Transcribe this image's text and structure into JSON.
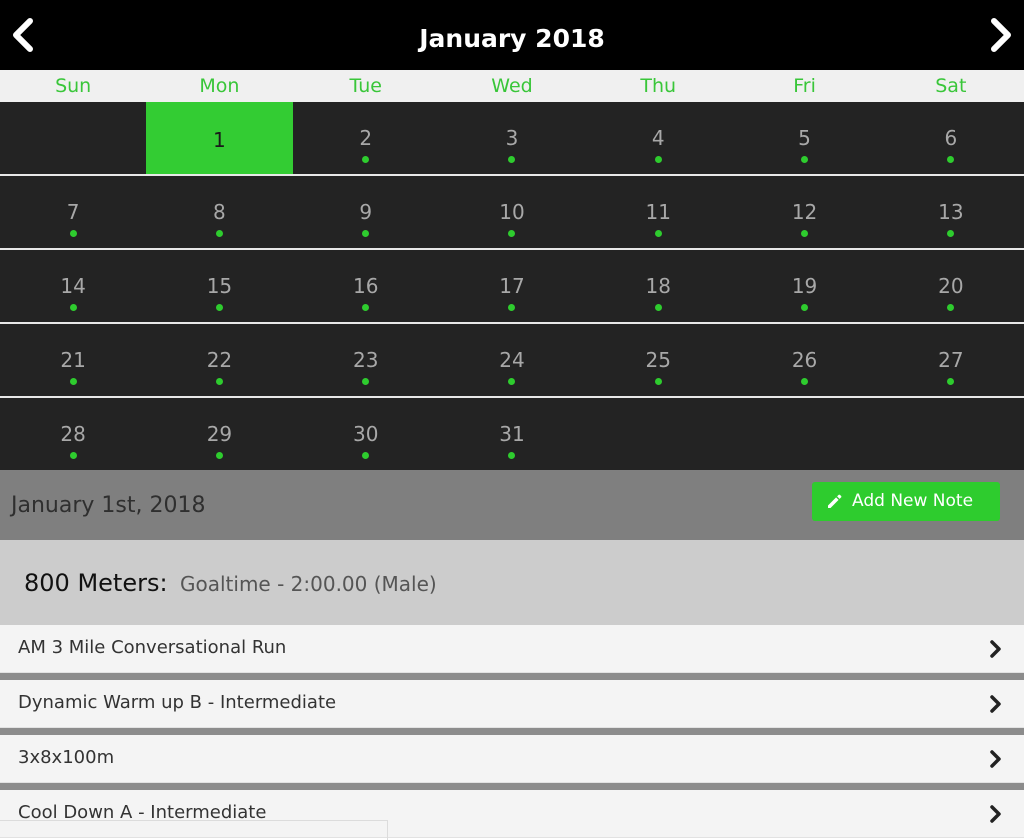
{
  "calendar": {
    "title": "January 2018",
    "weekdays": [
      "Sun",
      "Mon",
      "Tue",
      "Wed",
      "Thu",
      "Fri",
      "Sat"
    ],
    "weeks": [
      [
        null,
        1,
        2,
        3,
        4,
        5,
        6
      ],
      [
        7,
        8,
        9,
        10,
        11,
        12,
        13
      ],
      [
        14,
        15,
        16,
        17,
        18,
        19,
        20
      ],
      [
        21,
        22,
        23,
        24,
        25,
        26,
        27
      ],
      [
        28,
        29,
        30,
        31,
        null,
        null,
        null
      ]
    ],
    "selected_day": 1,
    "days_with_events": [
      2,
      3,
      4,
      5,
      6,
      7,
      8,
      9,
      10,
      11,
      12,
      13,
      14,
      15,
      16,
      17,
      18,
      19,
      20,
      21,
      22,
      23,
      24,
      25,
      26,
      27,
      28,
      29,
      30,
      31
    ],
    "prev_icon": "chevron-left-icon",
    "next_icon": "chevron-right-icon"
  },
  "selected_date": {
    "label": "January 1st, 2018",
    "add_note_label": "Add New Note",
    "add_note_icon": "pencil-icon"
  },
  "event": {
    "name": "800 Meters:",
    "detail": "Goaltime - 2:00.00 (Male)"
  },
  "workouts": [
    {
      "label": "AM 3 Mile Conversational Run"
    },
    {
      "label": "Dynamic Warm up B - Intermediate"
    },
    {
      "label": "3x8x100m"
    },
    {
      "label": "Cool Down A - Intermediate"
    }
  ],
  "colors": {
    "accent": "#33cc33",
    "header_bg": "#000000",
    "grid_bg": "#232323",
    "date_bar_bg": "#7f7f7f",
    "event_bg": "#cccccc"
  }
}
